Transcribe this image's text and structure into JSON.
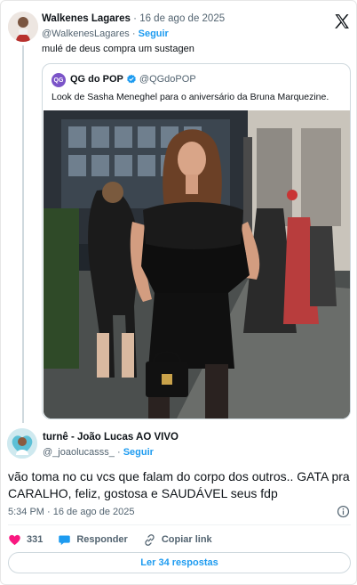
{
  "parent_tweet": {
    "name": "Walkenes Lagares",
    "separator": "·",
    "date": "16 de ago de 2025",
    "handle": "@WalkenesLagares",
    "follow_label": "Seguir",
    "text": "mulé de deus compra um sustagen"
  },
  "quoted_tweet": {
    "avatar_initials": "QG",
    "name": "QG do POP",
    "handle": "@QGdoPOP",
    "text": "Look de Sasha Meneghel para o aniversário da Bruna Marquezine."
  },
  "main_tweet": {
    "name": "turnê - João Lucas AO VIVO",
    "handle": "@_joaolucasss_",
    "separator": "·",
    "follow_label": "Seguir",
    "text": "vão toma no cu vcs que falam do corpo dos outros.. GATA pra CARALHO, feliz, gostosa e SAUDÁVEL seus fdp",
    "time": "5:34 PM · 16 de ago de 2025"
  },
  "actions": {
    "like_count": "331",
    "reply_label": "Responder",
    "copy_link_label": "Copiar link"
  },
  "replies_button_label": "Ler 34 respostas",
  "icons": {
    "brand": "x-logo-icon",
    "like": "heart-icon",
    "reply": "speech-bubble-icon",
    "copy": "link-icon",
    "info": "info-icon",
    "verified": "verified-badge-icon"
  },
  "colors": {
    "accent": "#1d9bf0",
    "like": "#f91880",
    "muted_text": "#536471",
    "border": "#cfd9de"
  }
}
